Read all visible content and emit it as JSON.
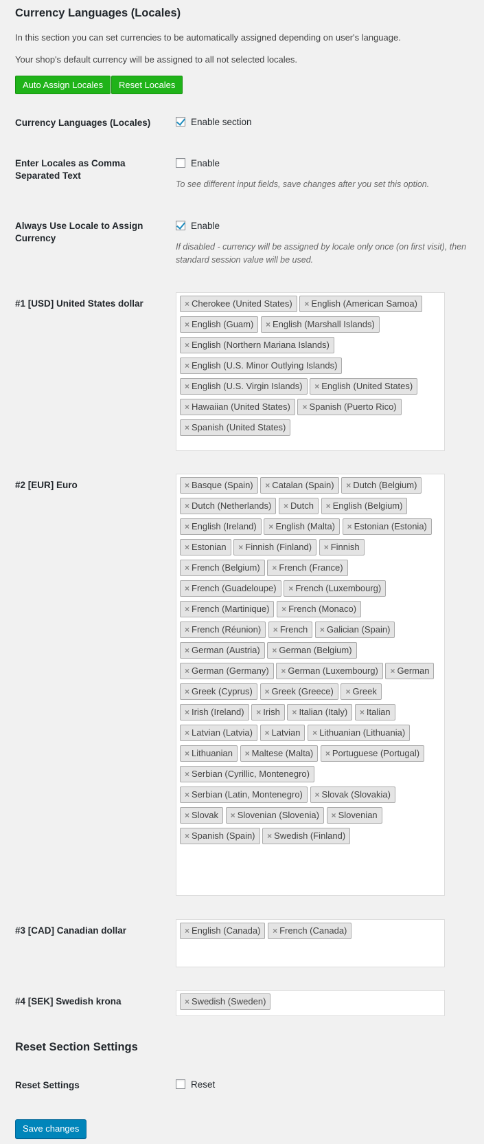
{
  "section": {
    "title": "Currency Languages (Locales)",
    "desc1": "In this section you can set currencies to be automatically assigned depending on user's language.",
    "desc2": "Your shop's default currency will be assigned to all not selected locales.",
    "auto_assign_label": "Auto Assign Locales",
    "reset_locales_label": "Reset Locales"
  },
  "rows": {
    "enable": {
      "label": "Currency Languages (Locales)",
      "checkbox_label": "Enable section",
      "checked": true
    },
    "csv": {
      "label": "Enter Locales as Comma Separated Text",
      "checkbox_label": "Enable",
      "checked": false,
      "hint": "To see different input fields, save changes after you set this option."
    },
    "always": {
      "label": "Always Use Locale to Assign Currency",
      "checkbox_label": "Enable",
      "checked": true,
      "hint": "If disabled - currency will be assigned by locale only once (on first visit), then standard session value will be used."
    }
  },
  "currencies": [
    {
      "label": "#1 [USD] United States dollar",
      "locales": [
        "Cherokee (United States)",
        "English (American Samoa)",
        "English (Guam)",
        "English (Marshall Islands)",
        "English (Northern Mariana Islands)",
        "English (U.S. Minor Outlying Islands)",
        "English (U.S. Virgin Islands)",
        "English (United States)",
        "Hawaiian (United States)",
        "Spanish (Puerto Rico)",
        "Spanish (United States)"
      ]
    },
    {
      "label": "#2 [EUR] Euro",
      "locales": [
        "Basque (Spain)",
        "Catalan (Spain)",
        "Dutch (Belgium)",
        "Dutch (Netherlands)",
        "Dutch",
        "English (Belgium)",
        "English (Ireland)",
        "English (Malta)",
        "Estonian (Estonia)",
        "Estonian",
        "Finnish (Finland)",
        "Finnish",
        "French (Belgium)",
        "French (France)",
        "French (Guadeloupe)",
        "French (Luxembourg)",
        "French (Martinique)",
        "French (Monaco)",
        "French (Réunion)",
        "French",
        "Galician (Spain)",
        "German (Austria)",
        "German (Belgium)",
        "German (Germany)",
        "German (Luxembourg)",
        "German",
        "Greek (Cyprus)",
        "Greek (Greece)",
        "Greek",
        "Irish (Ireland)",
        "Irish",
        "Italian (Italy)",
        "Italian",
        "Latvian (Latvia)",
        "Latvian",
        "Lithuanian (Lithuania)",
        "Lithuanian",
        "Maltese (Malta)",
        "Portuguese (Portugal)",
        "Serbian (Cyrillic, Montenegro)",
        "Serbian (Latin, Montenegro)",
        "Slovak (Slovakia)",
        "Slovak",
        "Slovenian (Slovenia)",
        "Slovenian",
        "Spanish (Spain)",
        "Swedish (Finland)"
      ]
    },
    {
      "label": "#3 [CAD] Canadian dollar",
      "locales": [
        "English (Canada)",
        "French (Canada)"
      ]
    },
    {
      "label": "#4 [SEK] Swedish krona",
      "locales": [
        "Swedish (Sweden)"
      ]
    }
  ],
  "reset": {
    "title": "Reset Section Settings",
    "label": "Reset Settings",
    "checkbox_label": "Reset",
    "checked": false
  },
  "save_label": "Save changes",
  "tag_remove_glyph": "×"
}
